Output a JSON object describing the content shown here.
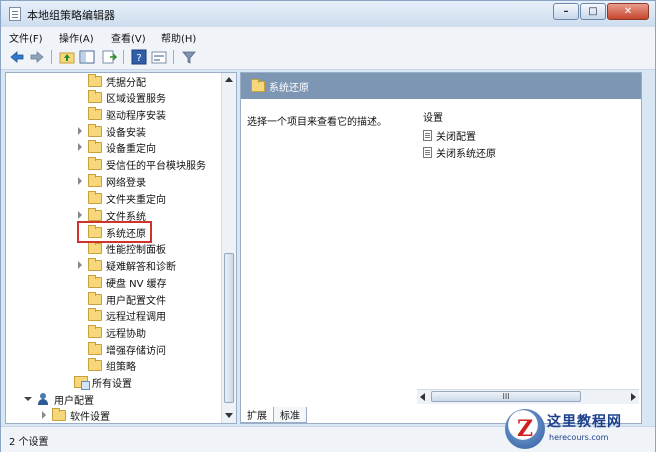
{
  "window": {
    "title": "本地组策略编辑器",
    "minimize": "–",
    "maximize": "□",
    "close": "✕"
  },
  "menu": {
    "file": "文件(F)",
    "action": "操作(A)",
    "view": "查看(V)",
    "help": "帮助(H)"
  },
  "tree": {
    "items": [
      {
        "label": "凭据分配",
        "expander": "none",
        "icon": "folder-icon"
      },
      {
        "label": "区域设置服务",
        "expander": "none",
        "icon": "folder-icon"
      },
      {
        "label": "驱动程序安装",
        "expander": "none",
        "icon": "folder-icon"
      },
      {
        "label": "设备安装",
        "expander": "collapsed",
        "icon": "folder-icon"
      },
      {
        "label": "设备重定向",
        "expander": "collapsed",
        "icon": "folder-icon"
      },
      {
        "label": "受信任的平台模块服务",
        "expander": "none",
        "icon": "folder-icon"
      },
      {
        "label": "网络登录",
        "expander": "collapsed",
        "icon": "folder-icon"
      },
      {
        "label": "文件夹重定向",
        "expander": "none",
        "icon": "folder-icon"
      },
      {
        "label": "文件系统",
        "expander": "collapsed",
        "icon": "folder-icon"
      },
      {
        "label": "系统还原",
        "expander": "none",
        "icon": "folder-icon",
        "selected": true
      },
      {
        "label": "性能控制面板",
        "expander": "none",
        "icon": "folder-icon"
      },
      {
        "label": "疑难解答和诊断",
        "expander": "collapsed",
        "icon": "folder-icon"
      },
      {
        "label": "硬盘 NV 缓存",
        "expander": "none",
        "icon": "folder-icon"
      },
      {
        "label": "用户配置文件",
        "expander": "none",
        "icon": "folder-icon"
      },
      {
        "label": "远程过程调用",
        "expander": "none",
        "icon": "folder-icon"
      },
      {
        "label": "远程协助",
        "expander": "none",
        "icon": "folder-icon"
      },
      {
        "label": "增强存储访问",
        "expander": "none",
        "icon": "folder-icon"
      },
      {
        "label": "组策略",
        "expander": "none",
        "icon": "folder-icon"
      },
      {
        "label": "所有设置",
        "expander": "none",
        "icon": "settings-icon"
      },
      {
        "label": "用户配置",
        "expander": "expanded",
        "icon": "user-icon"
      },
      {
        "label": "软件设置",
        "expander": "collapsed",
        "icon": "folder-icon"
      }
    ]
  },
  "detail": {
    "header_title": "系统还原",
    "description": "选择一个项目来查看它的描述。",
    "column_header": "设置",
    "settings": [
      "关闭配置",
      "关闭系统还原"
    ],
    "hscroll_thumb": "III"
  },
  "tabs": {
    "extended": "扩展",
    "standard": "标准"
  },
  "status": {
    "text": "2 个设置"
  },
  "watermark": {
    "logo_letter": "Z",
    "site_name": "这里教程网",
    "url": "herecours.com"
  }
}
